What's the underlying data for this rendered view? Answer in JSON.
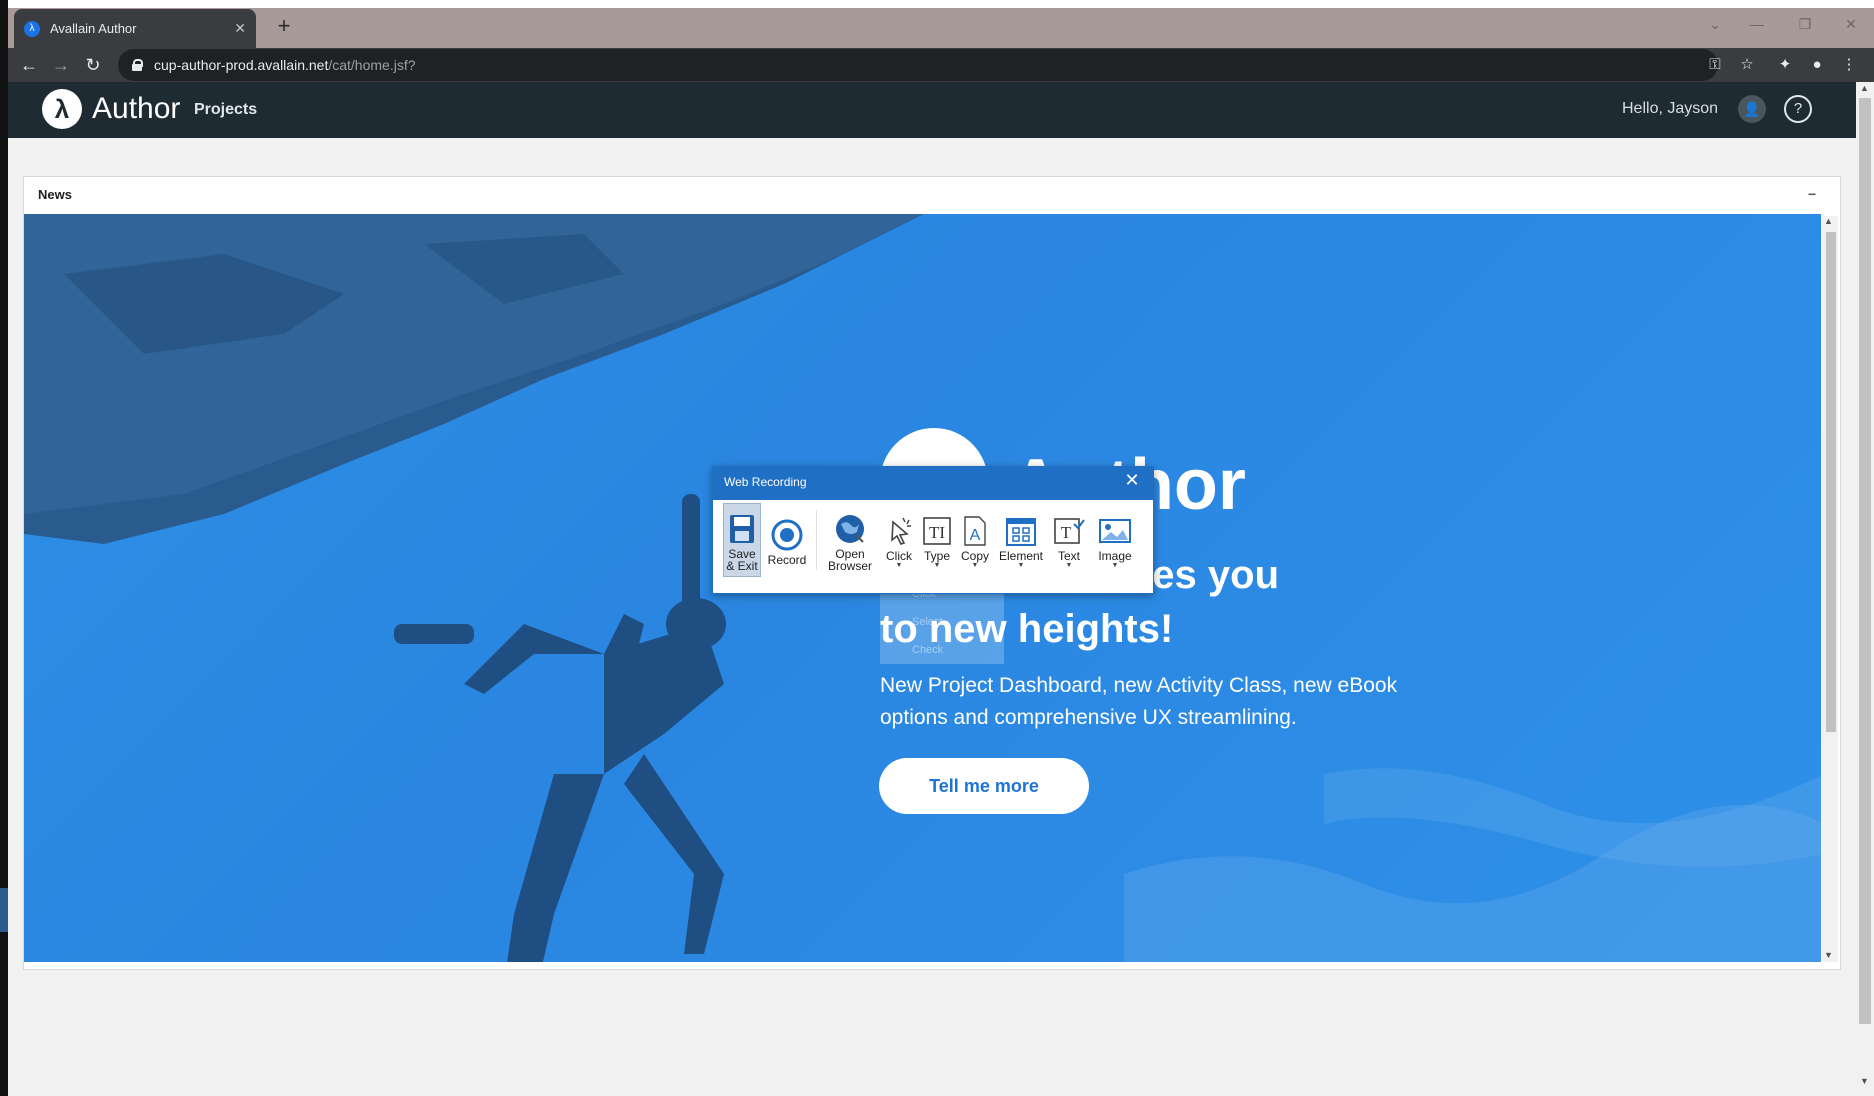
{
  "browser": {
    "tab_title": "Avallain Author",
    "tab_close": "✕",
    "new_tab": "+",
    "url_host": "cup-author-prod.avallain.net",
    "url_path": "/cat/home.jsf?"
  },
  "app": {
    "brand": "Author",
    "nav_projects": "Projects",
    "greeting": "Hello, Jayson",
    "help_label": "?"
  },
  "news": {
    "panel_title": "News",
    "collapse_label": "−",
    "banner": {
      "brand": "Author",
      "heading_line1": "es you",
      "heading_line2": "to new heights!",
      "description": "New Project Dashboard, new Activity Class, new eBook options and comprehensive UX streamlining.",
      "cta": "Tell me more"
    }
  },
  "ghost_menu": {
    "items": [
      "Click",
      "Select",
      "Check"
    ]
  },
  "web_recording": {
    "title": "Web Recording",
    "close": "✕",
    "buttons": {
      "save_exit_line1": "Save",
      "save_exit_line2": "& Exit",
      "record": "Record",
      "open_browser_line1": "Open",
      "open_browser_line2": "Browser",
      "click": "Click",
      "type": "Type",
      "copy": "Copy",
      "element": "Element",
      "text": "Text",
      "image": "Image"
    }
  },
  "colors": {
    "banner_blue": "#2a86e0",
    "header_dark": "#1e2b33",
    "dialog_blue": "#1f6fc4"
  }
}
